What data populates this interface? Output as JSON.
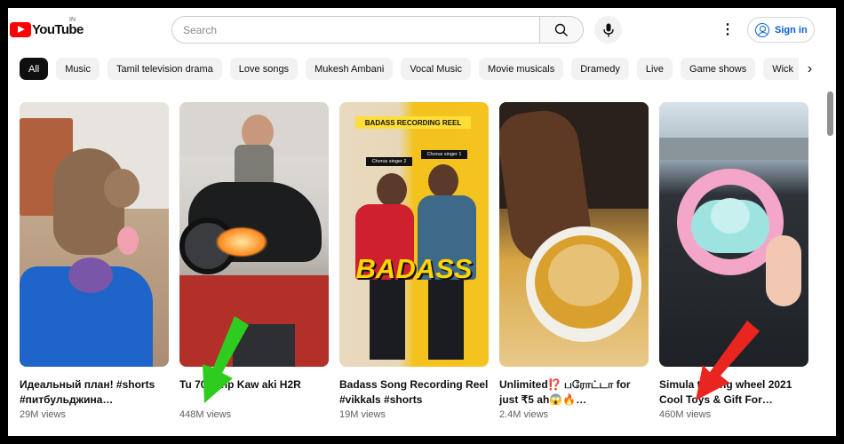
{
  "header": {
    "logo_text": "YouTube",
    "country_code": "IN",
    "search_placeholder": "Search",
    "signin_label": "Sign in"
  },
  "chips": [
    "All",
    "Music",
    "Tamil television drama",
    "Love songs",
    "Mukesh Ambani",
    "Vocal Music",
    "Movie musicals",
    "Dramedy",
    "Live",
    "Game shows",
    "Wick"
  ],
  "videos": [
    {
      "title": "Идеальный план! #shorts #питбульджина…",
      "views": "29M views",
      "overlay": ""
    },
    {
      "title": "Tu        70+whp Kaw   aki H2R",
      "views": "448M views",
      "overlay": ""
    },
    {
      "title": "Badass Song Recording Reel #vikkals #shorts",
      "views": "19M views",
      "overlay": "BADASS",
      "header_text": "BADASS RECORDING REEL",
      "label1": "Chorus singer 2",
      "label2": "Chorus singer 1"
    },
    {
      "title": "Unlimited⁉️ பரோட்டா for just ₹5 ah😱🔥…",
      "views": "2.4M views",
      "overlay": ""
    },
    {
      "title": "Simula    teering wheel 2021 Cool Toys & Gift For…",
      "views": "460M views",
      "overlay": ""
    }
  ],
  "colors": {
    "brand": "#ff0000",
    "link": "#065fd4",
    "arrow_green": "#2ecc1f",
    "arrow_red": "#e8261f"
  }
}
